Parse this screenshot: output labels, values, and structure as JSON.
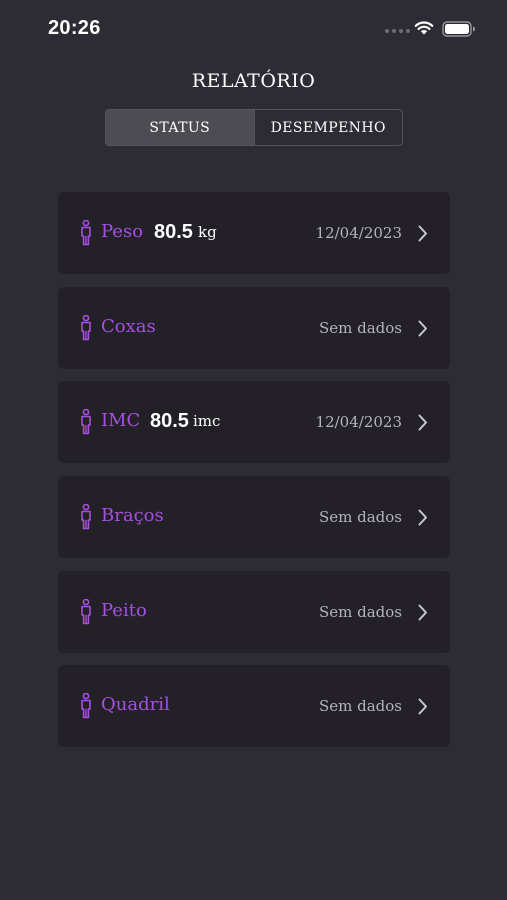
{
  "status_bar": {
    "time": "20:26"
  },
  "header": {
    "title": "RELATÓRIO"
  },
  "tabs": [
    {
      "label": "STATUS",
      "active": true
    },
    {
      "label": "DESEMPENHO",
      "active": false
    }
  ],
  "colors": {
    "accent": "#a64fe0",
    "background": "#2d2b33",
    "card": "#232127"
  },
  "metrics": [
    {
      "name": "Peso",
      "value": "80.5",
      "unit": "kg",
      "date": "12/04/2023",
      "icon": "person-icon"
    },
    {
      "name": "Coxas",
      "value": "",
      "unit": "",
      "date": "Sem dados",
      "icon": "person-icon"
    },
    {
      "name": "IMC",
      "value": "80.5",
      "unit": "imc",
      "date": "12/04/2023",
      "icon": "person-icon"
    },
    {
      "name": "Braços",
      "value": "",
      "unit": "",
      "date": "Sem dados",
      "icon": "person-icon"
    },
    {
      "name": "Peito",
      "value": "",
      "unit": "",
      "date": "Sem dados",
      "icon": "person-icon"
    },
    {
      "name": "Quadril",
      "value": "",
      "unit": "",
      "date": "Sem dados",
      "icon": "person-icon"
    }
  ]
}
